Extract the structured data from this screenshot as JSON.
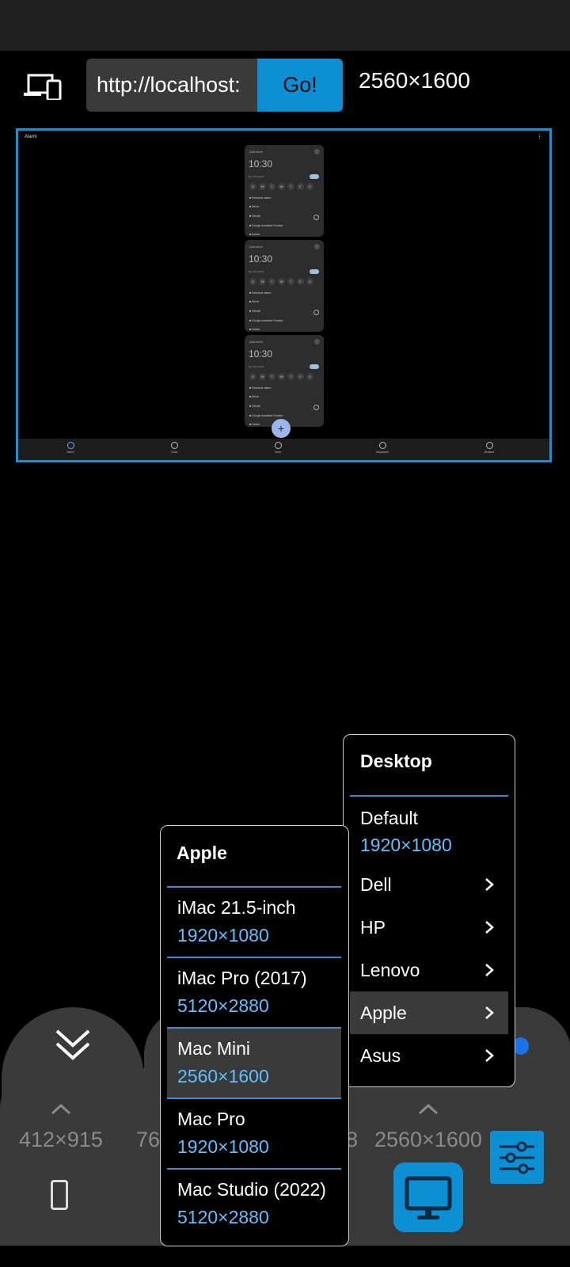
{
  "toolbar": {
    "url_value": "http://localhost:",
    "go_label": "Go!",
    "current_resolution": "2560×1600"
  },
  "preview": {
    "app_title": "Alarm",
    "cards": [
      {
        "label": "Add label",
        "time": "10:30",
        "schedule": "Not scheduled",
        "days": [
          "S",
          "M",
          "T",
          "W",
          "T",
          "F",
          "S"
        ],
        "rows": [
          "Schedule alarm",
          "Silent",
          "Vibrate",
          "Google Assistant Routine",
          "Delete"
        ]
      },
      {
        "label": "Add label",
        "time": "10:30",
        "schedule": "Not scheduled",
        "days": [
          "S",
          "M",
          "T",
          "W",
          "T",
          "F",
          "S"
        ],
        "rows": [
          "Schedule alarm",
          "Silent",
          "Vibrate",
          "Google Assistant Routine",
          "Delete"
        ]
      },
      {
        "label": "Add label",
        "time": "10:30",
        "schedule": "Not scheduled",
        "days": [
          "S",
          "M",
          "T",
          "W",
          "T",
          "F",
          "S"
        ],
        "rows": [
          "Schedule alarm",
          "Silent",
          "Vibrate",
          "Google Assistant Routine",
          "Delete"
        ]
      }
    ],
    "fab": "+",
    "nav": [
      "Alarm",
      "Clock",
      "Timer",
      "Stopwatch",
      "Bedtime"
    ]
  },
  "tray": {
    "sizes": [
      "412×915",
      "76",
      "8",
      "2560×1600"
    ]
  },
  "desktop_menu": {
    "title": "Desktop",
    "default_name": "Default",
    "default_res": "1920×1080",
    "items": [
      "Dell",
      "HP",
      "Lenovo",
      "Apple",
      "Asus"
    ]
  },
  "apple_menu": {
    "title": "Apple",
    "items": [
      {
        "name": "iMac 21.5-inch",
        "res": "1920×1080"
      },
      {
        "name": "iMac Pro (2017)",
        "res": "5120×2880"
      },
      {
        "name": "Mac Mini",
        "res": "2560×1600"
      },
      {
        "name": "Mac Pro",
        "res": "1920×1080"
      },
      {
        "name": "Mac Studio (2022)",
        "res": "5120×2880"
      }
    ]
  },
  "colors": {
    "accent": "#0d8fd3",
    "resolution_text": "#5fc0ff",
    "tray": "#3a3a3a"
  }
}
